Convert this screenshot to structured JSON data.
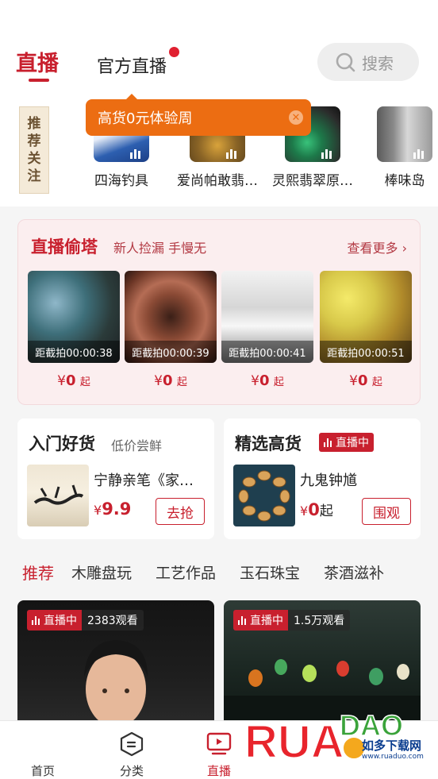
{
  "header": {
    "tabs": [
      {
        "label": "直播",
        "active": true
      },
      {
        "label": "官方直播",
        "active": false
      }
    ],
    "search_label": "搜索"
  },
  "follow": {
    "tag_chars": [
      "推",
      "荐",
      "关",
      "注"
    ],
    "tooltip": "高货0元体验周",
    "items": [
      {
        "label": "四海钓具"
      },
      {
        "label": "爱尚帕敢翡…"
      },
      {
        "label": "灵熙翡翠原…"
      },
      {
        "label": "棒味岛"
      }
    ]
  },
  "auction": {
    "title": "直播偷塔",
    "subtitle": "新人捡漏 手慢无",
    "more_label": "查看更多 ›",
    "lots": [
      {
        "countdown": "距截拍00:00:38",
        "currency": "¥",
        "price": "0",
        "suffix": "起"
      },
      {
        "countdown": "距截拍00:00:39",
        "currency": "¥",
        "price": "0",
        "suffix": "起"
      },
      {
        "countdown": "距截拍00:00:41",
        "currency": "¥",
        "price": "0",
        "suffix": "起"
      },
      {
        "countdown": "距截拍00:00:51",
        "currency": "¥",
        "price": "0",
        "suffix": "起"
      }
    ]
  },
  "promos": [
    {
      "title": "入门好货",
      "subtitle": "低价尝鲜",
      "item_name": "宁静亲笔《家…",
      "currency": "¥",
      "price": "9.9",
      "suffix": "",
      "button": "去抢"
    },
    {
      "title": "精选高货",
      "badge": "直播中",
      "item_name": "九鬼钟馗",
      "currency": "¥",
      "price": "0",
      "suffix": "起",
      "button": "围观"
    }
  ],
  "categories": [
    {
      "label": "推荐",
      "active": true
    },
    {
      "label": "木雕盘玩"
    },
    {
      "label": "工艺作品"
    },
    {
      "label": "玉石珠宝"
    },
    {
      "label": "茶酒滋补"
    }
  ],
  "live_cards": [
    {
      "status": "直播中",
      "viewers": "2383观看"
    },
    {
      "status": "直播中",
      "viewers": "1.5万观看"
    }
  ],
  "nav": [
    {
      "label": "首页"
    },
    {
      "label": "分类"
    },
    {
      "label": "直播",
      "active": true
    }
  ],
  "watermark": {
    "brand": "RUANDAO",
    "name": "如多下载网",
    "url": "www.ruaduo.com"
  },
  "colors": {
    "accent": "#c8202e",
    "tooltip": "#ec6d12",
    "background": "#f5f5f5"
  }
}
